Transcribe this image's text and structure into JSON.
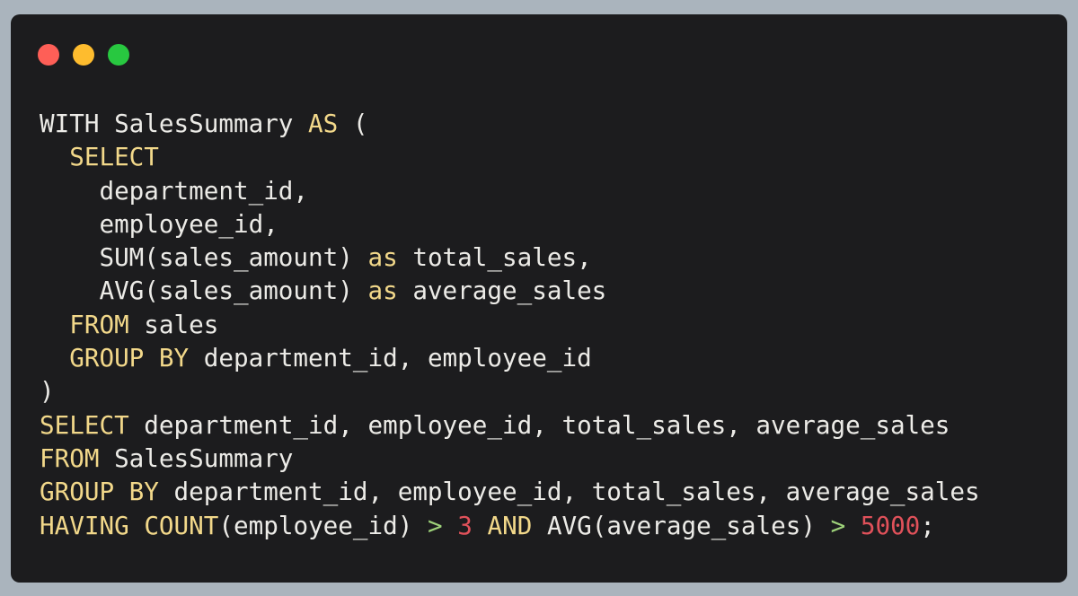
{
  "window": {
    "controls": [
      {
        "name": "close-button",
        "color": "#fe5f57"
      },
      {
        "name": "minimize-button",
        "color": "#febc2e"
      },
      {
        "name": "maximize-button",
        "color": "#28c840"
      }
    ]
  },
  "colors": {
    "background": "#aab4bd",
    "editor": "#1c1c1e",
    "text": "#ecebe7",
    "keyword": "#f2d88a",
    "operator": "#9ed27a",
    "number": "#e0515a"
  },
  "code": {
    "lines": [
      [
        {
          "t": "WITH SalesSummary ",
          "k": "plain"
        },
        {
          "t": "AS",
          "k": "kw"
        },
        {
          "t": " (",
          "k": "plain"
        }
      ],
      [
        {
          "t": "  ",
          "k": "plain"
        },
        {
          "t": "SELECT",
          "k": "kw"
        }
      ],
      [
        {
          "t": "    department_id,",
          "k": "plain"
        }
      ],
      [
        {
          "t": "    employee_id,",
          "k": "plain"
        }
      ],
      [
        {
          "t": "    SUM(sales_amount) ",
          "k": "plain"
        },
        {
          "t": "as",
          "k": "kw"
        },
        {
          "t": " total_sales,",
          "k": "plain"
        }
      ],
      [
        {
          "t": "    AVG(sales_amount) ",
          "k": "plain"
        },
        {
          "t": "as",
          "k": "kw"
        },
        {
          "t": " average_sales",
          "k": "plain"
        }
      ],
      [
        {
          "t": "  ",
          "k": "plain"
        },
        {
          "t": "FROM",
          "k": "kw"
        },
        {
          "t": " sales",
          "k": "plain"
        }
      ],
      [
        {
          "t": "  ",
          "k": "plain"
        },
        {
          "t": "GROUP BY",
          "k": "kw"
        },
        {
          "t": " department_id, employee_id",
          "k": "plain"
        }
      ],
      [
        {
          "t": ")",
          "k": "plain"
        }
      ],
      [
        {
          "t": "SELECT",
          "k": "kw"
        },
        {
          "t": " department_id, employee_id, total_sales, average_sales",
          "k": "plain"
        }
      ],
      [
        {
          "t": "FROM",
          "k": "kw"
        },
        {
          "t": " SalesSummary",
          "k": "plain"
        }
      ],
      [
        {
          "t": "GROUP BY",
          "k": "kw"
        },
        {
          "t": " department_id, employee_id, total_sales, average_sales",
          "k": "plain"
        }
      ],
      [
        {
          "t": "HAVING",
          "k": "kw"
        },
        {
          "t": " ",
          "k": "plain"
        },
        {
          "t": "COUNT",
          "k": "kw"
        },
        {
          "t": "(employee_id) ",
          "k": "plain"
        },
        {
          "t": ">",
          "k": "op"
        },
        {
          "t": " ",
          "k": "plain"
        },
        {
          "t": "3",
          "k": "num"
        },
        {
          "t": " ",
          "k": "plain"
        },
        {
          "t": "AND",
          "k": "kw"
        },
        {
          "t": " AVG(average_sales) ",
          "k": "plain"
        },
        {
          "t": ">",
          "k": "op"
        },
        {
          "t": " ",
          "k": "plain"
        },
        {
          "t": "5000",
          "k": "num"
        },
        {
          "t": ";",
          "k": "plain"
        }
      ]
    ]
  }
}
